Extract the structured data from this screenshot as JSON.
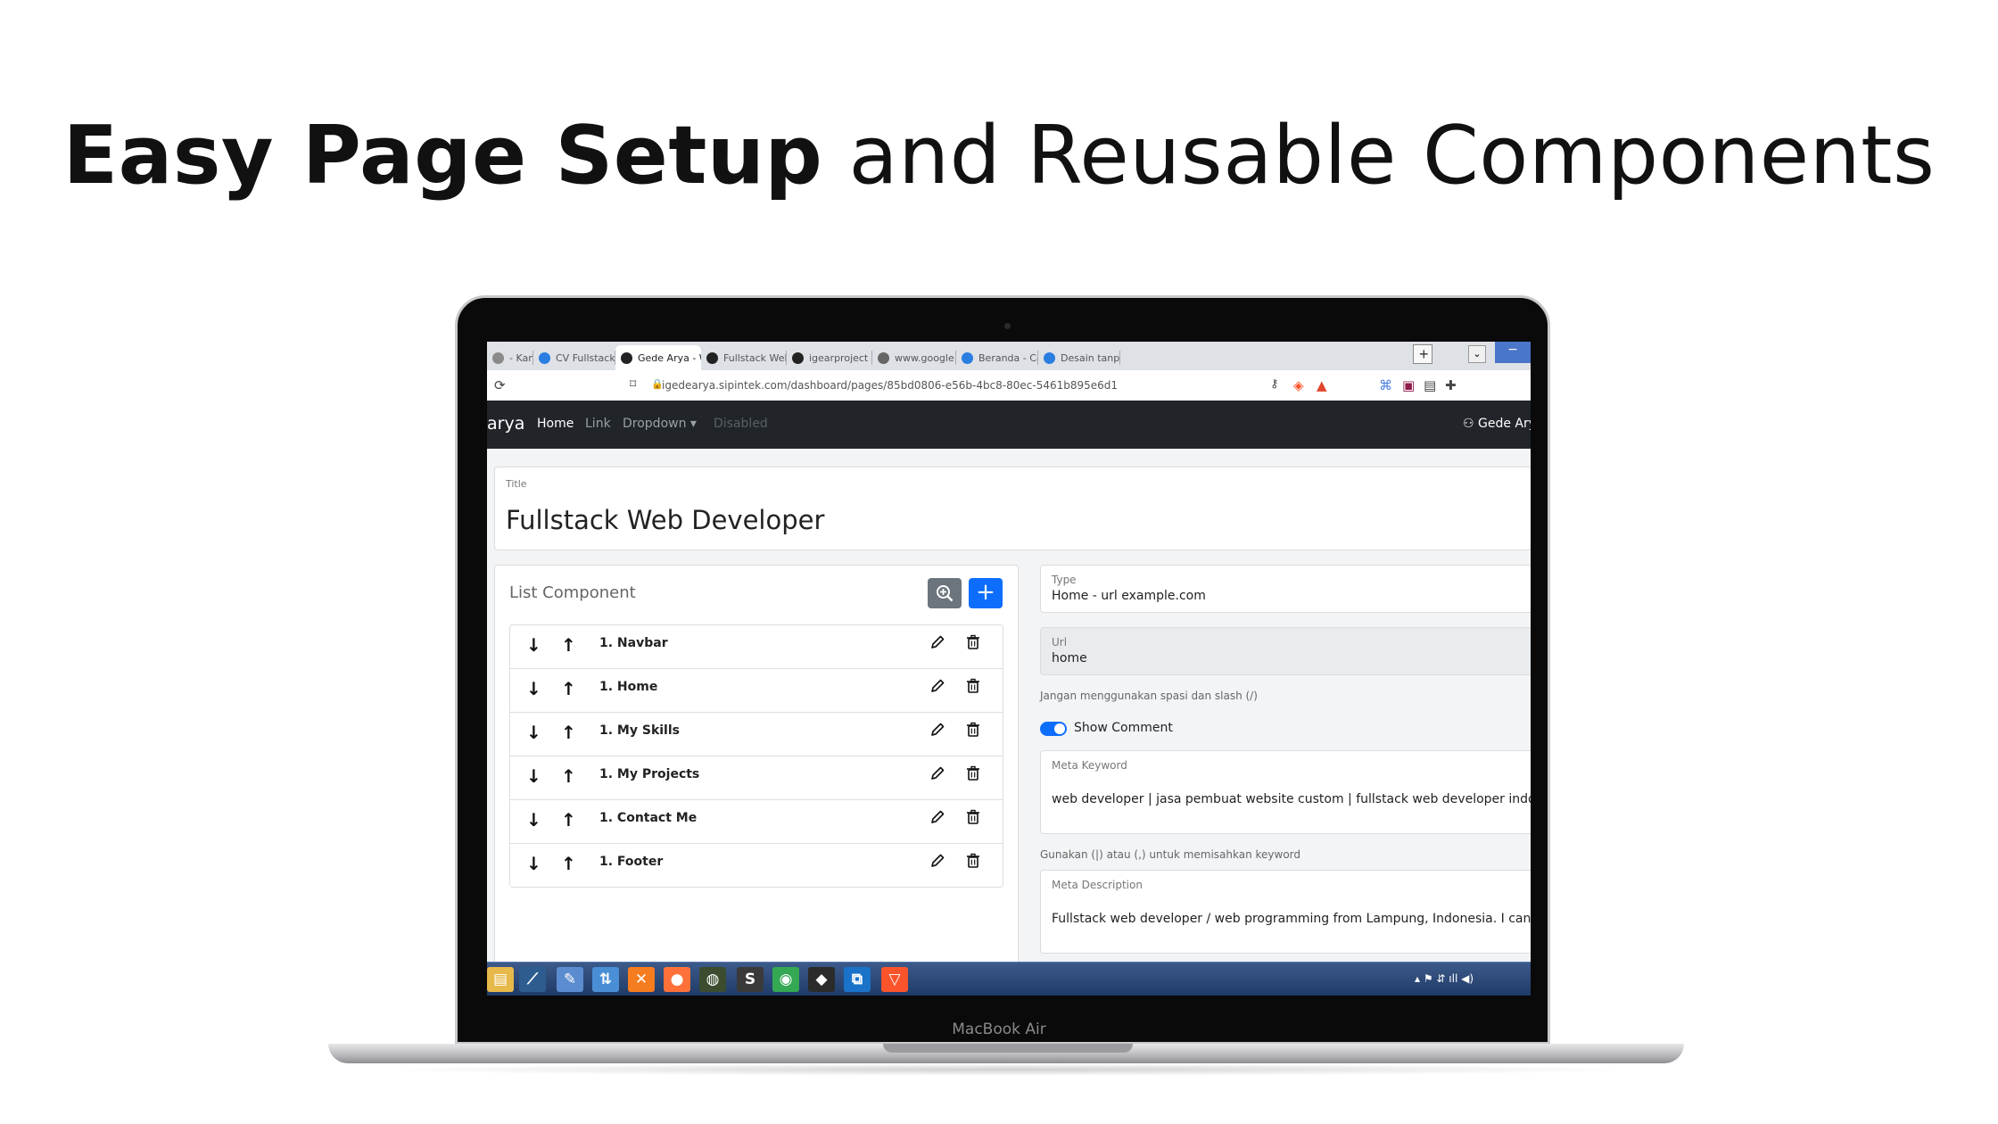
{
  "headline": {
    "bold": "Easy Page Setup",
    "light": " and Reusable Components"
  },
  "laptop": {
    "brand": "MacBook Air"
  },
  "browser": {
    "tabs": [
      {
        "label": "- Kamva/my",
        "icon": "window-icon",
        "color": "#8a8a8a"
      },
      {
        "label": "CV Fullstack Web D",
        "icon": "canva-icon",
        "color": "#2a7de1"
      },
      {
        "label": "Gede Arya - We",
        "icon": "app-icon",
        "color": "#222222",
        "active": true
      },
      {
        "label": "Fullstack Web Deve",
        "icon": "app-icon",
        "color": "#222222"
      },
      {
        "label": "igearproject (igear",
        "icon": "github-icon",
        "color": "#222222"
      },
      {
        "label": "www.google.com",
        "icon": "globe-icon",
        "color": "#666666"
      },
      {
        "label": "Beranda - Canva",
        "icon": "canva-icon",
        "color": "#2a7de1"
      },
      {
        "label": "Desain tanpa judul",
        "icon": "canva-icon",
        "color": "#2a7de1"
      }
    ],
    "close_glyph": "×",
    "newtab_glyph": "+",
    "dropdown_glyph": "⌄",
    "minimize_glyph": "−",
    "url": "igedearya.sipintek.com/dashboard/pages/85bd0806-e56b-4bc8-80ec-5461b895e6d1"
  },
  "navbar": {
    "brand": "arya",
    "items": [
      "Home",
      "Link",
      "Dropdown ▾",
      "Disabled"
    ],
    "user": "Gede Arya"
  },
  "title_field": {
    "label": "Title",
    "value": "Fullstack Web Developer"
  },
  "list": {
    "title": "List Component",
    "add_glyph": "+",
    "rows": [
      "1. Navbar",
      "1. Home",
      "1. My Skills",
      "1. My Projects",
      "1. Contact Me",
      "1. Footer"
    ],
    "down_glyph": "↓",
    "up_glyph": "↑"
  },
  "form": {
    "type": {
      "label": "Type",
      "value": "Home - url example.com"
    },
    "url": {
      "label": "Url",
      "value": "home",
      "help": "Jangan menggunakan spasi dan slash (/)"
    },
    "show_comment": {
      "label": "Show Comment",
      "checked": true
    },
    "meta_keyword": {
      "label": "Meta Keyword",
      "value": "web developer | jasa pembuat website custom | fullstack web developer indonesia",
      "help": "Gunakan (|) atau (,) untuk memisahkan keyword"
    },
    "meta_description": {
      "label": "Meta Description",
      "value": "Fullstack web developer / web programming from Lampung, Indonesia. I can create"
    }
  },
  "taskbar": {
    "apps": [
      {
        "name": "file-explorer-icon",
        "color": "#e7b84a",
        "glyph": "▤"
      },
      {
        "name": "mysql-workbench-icon",
        "color": "#2d5d8f",
        "glyph": "⟋"
      },
      {
        "name": "paint-icon",
        "color": "#5b8ccf",
        "glyph": "✎"
      },
      {
        "name": "network-icon",
        "color": "#4a8fd6",
        "glyph": "⇅"
      },
      {
        "name": "xampp-icon",
        "color": "#f57c1f",
        "glyph": "✕"
      },
      {
        "name": "firefox-icon",
        "color": "#ff7139",
        "glyph": "●"
      },
      {
        "name": "chart-app-icon",
        "color": "#3b4d2e",
        "glyph": "◍"
      },
      {
        "name": "sublime-icon",
        "color": "#3a3a3a",
        "glyph": "S"
      },
      {
        "name": "chrome-icon",
        "color": "#34a853",
        "glyph": "◉"
      },
      {
        "name": "inkscape-icon",
        "color": "#2b2b2b",
        "glyph": "◆"
      },
      {
        "name": "vscode-icon",
        "color": "#1a73c8",
        "glyph": "⧉"
      },
      {
        "name": "brave-icon",
        "color": "#fb542b",
        "glyph": "▽"
      }
    ],
    "tray": "▴  ⚑  ⇵  ıll  ◀)"
  }
}
